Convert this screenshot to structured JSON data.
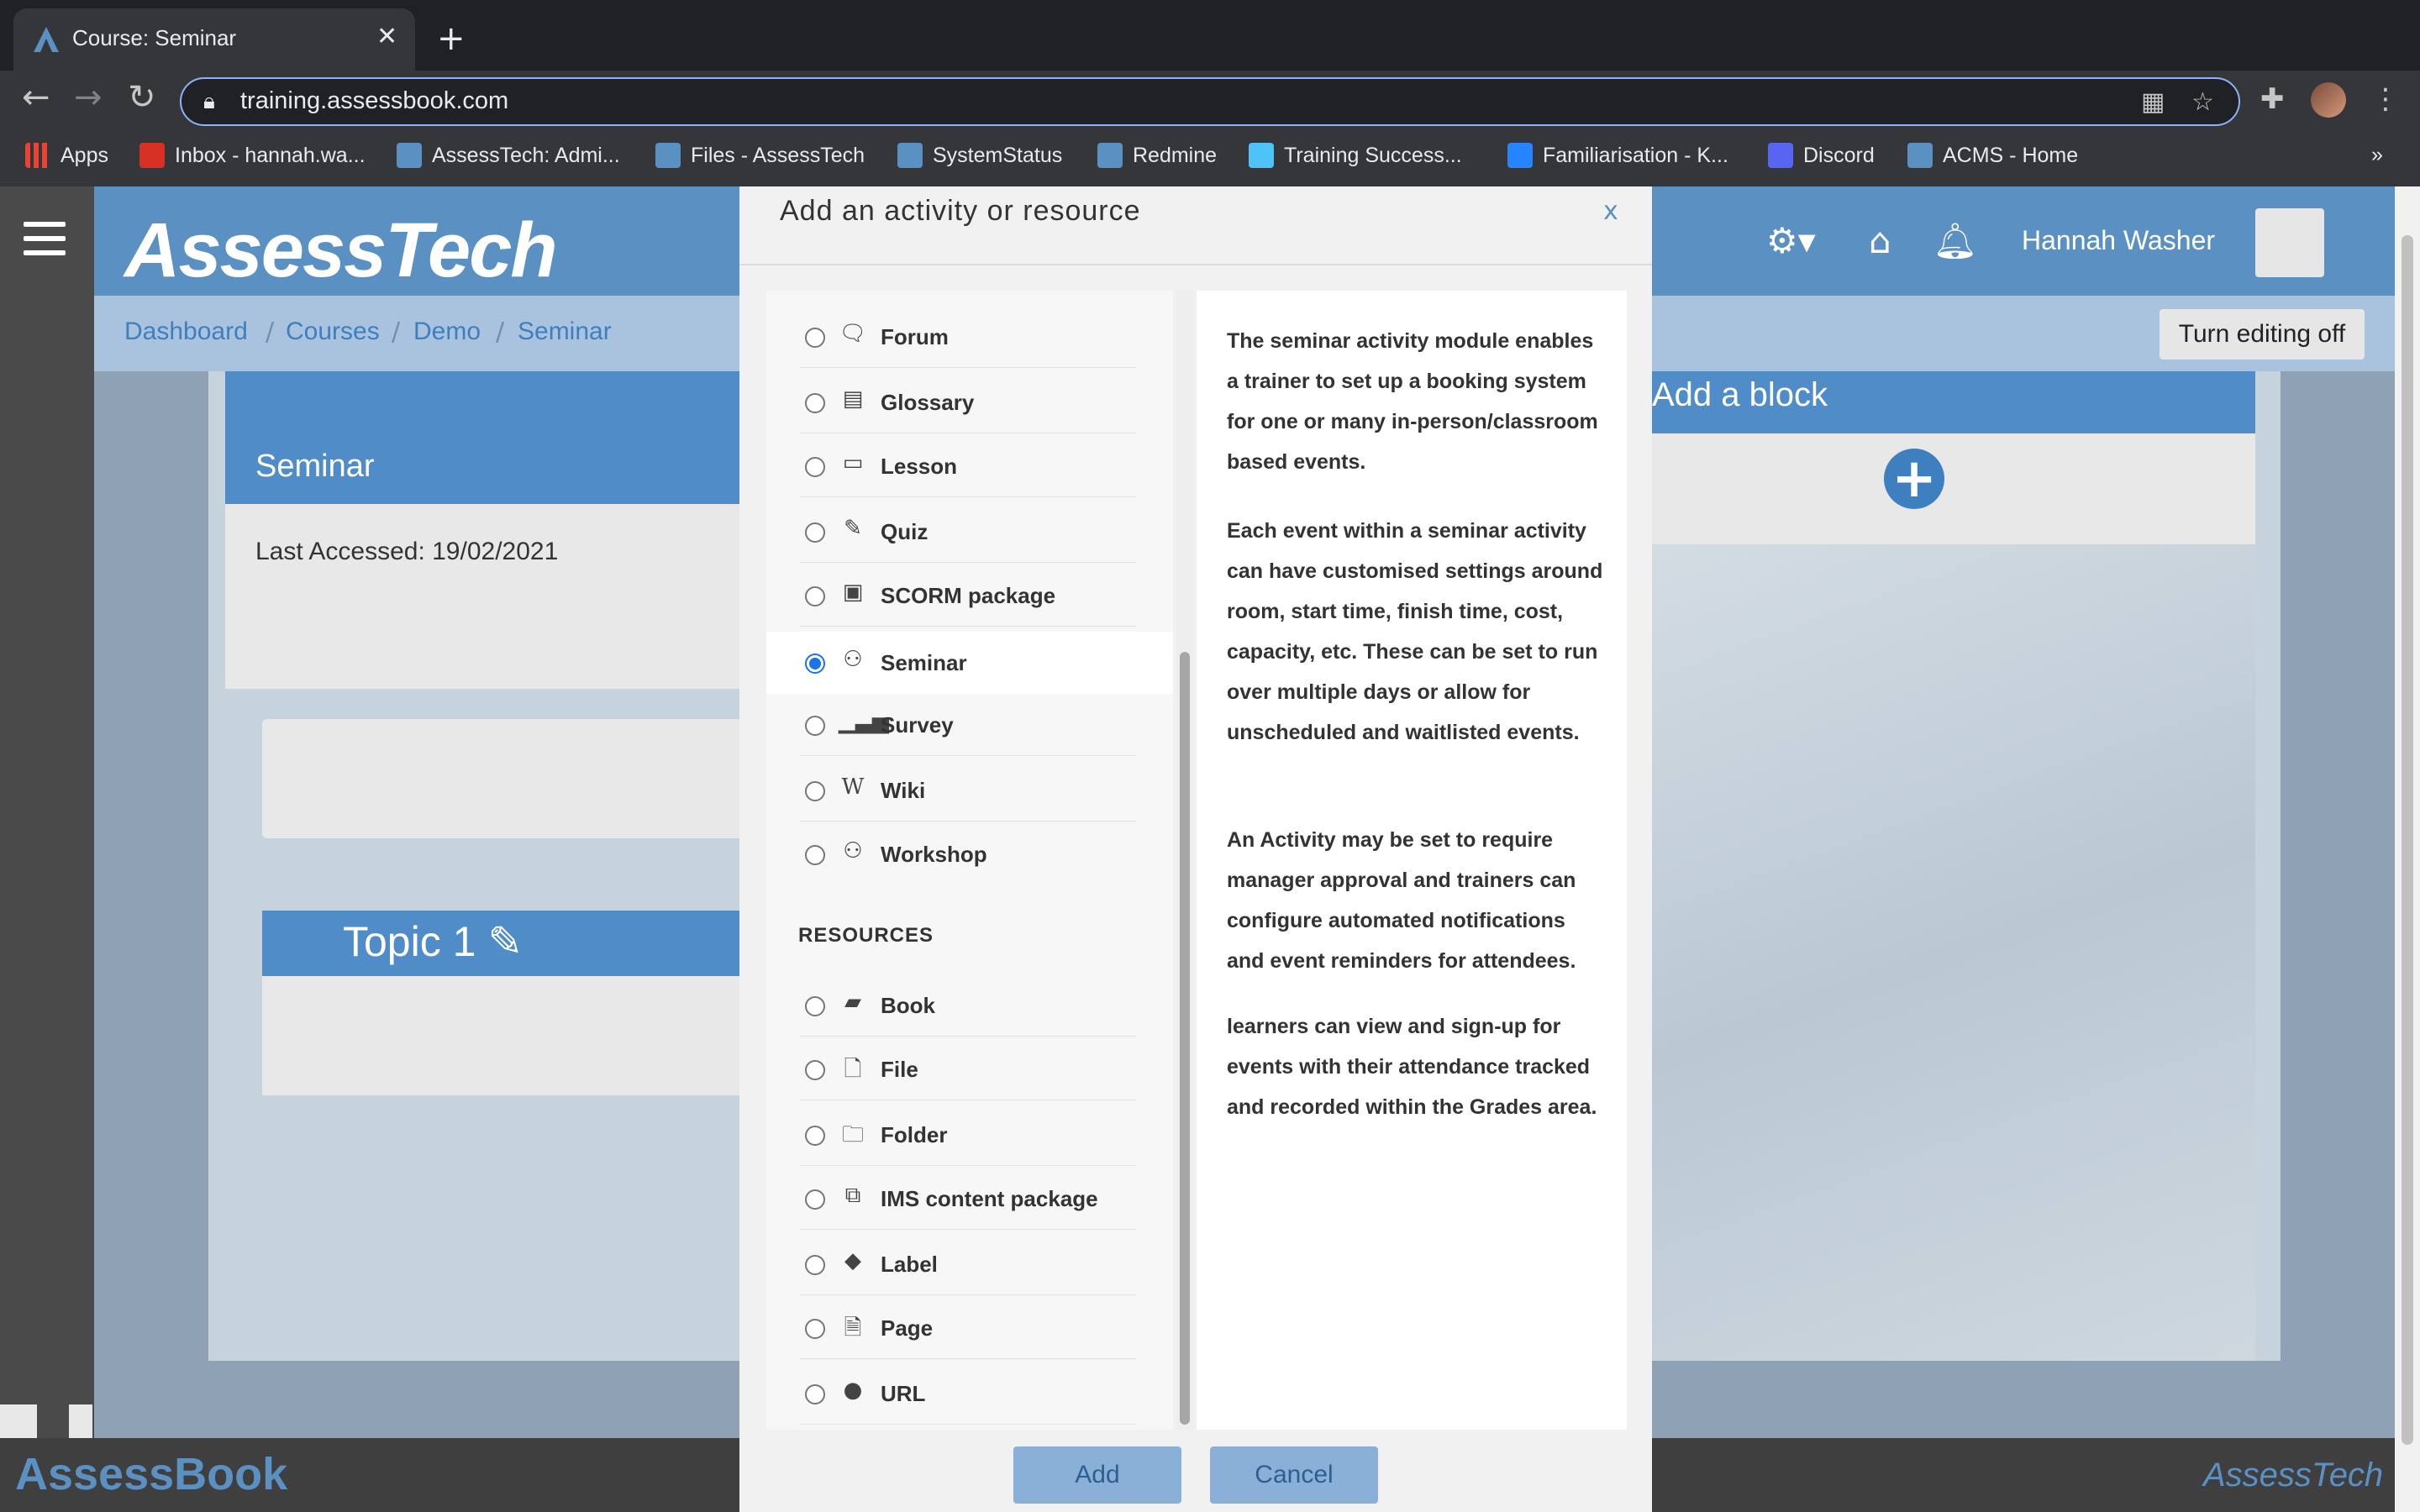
{
  "browser": {
    "tab_title": "Course: Seminar",
    "url": "training.assessbook.com",
    "bookmarks": [
      {
        "label": "Apps",
        "color": "#ea4335"
      },
      {
        "label": "Inbox - hannah.wa...",
        "color": "#d93025"
      },
      {
        "label": "AssessTech: Admi...",
        "color": "#5b90c2"
      },
      {
        "label": "Files - AssessTech",
        "color": "#5b90c2"
      },
      {
        "label": "SystemStatus",
        "color": "#5b90c2"
      },
      {
        "label": "Redmine",
        "color": "#5b90c2"
      },
      {
        "label": "Training Success...",
        "color": "#4fc3f7"
      },
      {
        "label": "Familiarisation - K...",
        "color": "#2684ff"
      },
      {
        "label": "Discord",
        "color": "#5865f2"
      },
      {
        "label": "ACMS - Home",
        "color": "#5b90c2"
      }
    ],
    "more": "»"
  },
  "site": {
    "logo": "AssessTech",
    "username": "Hannah Washer",
    "breadcrumbs": [
      "Dashboard",
      "Courses",
      "Demo",
      "Seminar"
    ],
    "turn_editing": "Turn editing off",
    "card_title": "Seminar",
    "last_accessed": "Last Accessed: 19/02/2021",
    "topic_title": "Topic 1",
    "add_block": "Add a block",
    "footer_logo": "AssessBook",
    "footer_logo_right": "AssessTech",
    "accent": "#5b90c2"
  },
  "modal": {
    "title": "Add an activity or resource",
    "close": "x",
    "activities": [
      {
        "label": "Forum",
        "icon": "forum-icon"
      },
      {
        "label": "Glossary",
        "icon": "glossary-icon"
      },
      {
        "label": "Lesson",
        "icon": "lesson-icon"
      },
      {
        "label": "Quiz",
        "icon": "quiz-icon"
      },
      {
        "label": "SCORM package",
        "icon": "scorm-icon"
      },
      {
        "label": "Seminar",
        "icon": "seminar-icon",
        "selected": true
      },
      {
        "label": "Survey",
        "icon": "survey-icon"
      },
      {
        "label": "Wiki",
        "icon": "wiki-icon"
      },
      {
        "label": "Workshop",
        "icon": "workshop-icon"
      }
    ],
    "resources_heading": "RESOURCES",
    "resources": [
      {
        "label": "Book",
        "icon": "book-icon"
      },
      {
        "label": "File",
        "icon": "file-icon"
      },
      {
        "label": "Folder",
        "icon": "folder-icon"
      },
      {
        "label": "IMS content package",
        "icon": "ims-package-icon"
      },
      {
        "label": "Label",
        "icon": "label-icon"
      },
      {
        "label": "Page",
        "icon": "page-icon"
      },
      {
        "label": "URL",
        "icon": "url-icon"
      }
    ],
    "description": [
      "The seminar activity module enables a trainer to set up a booking system for one or many in-person/classroom based events.",
      "Each event within a seminar activity can have customised settings around room, start time, finish time, cost, capacity, etc. These can be set to run over multiple days or allow for unscheduled and waitlisted events.",
      "An Activity may be set to require manager approval and trainers can configure automated notifications and event reminders for attendees.",
      "learners can view and sign-up for events with their attendance tracked and recorded within the Grades area."
    ],
    "add_button": "Add",
    "cancel_button": "Cancel"
  }
}
